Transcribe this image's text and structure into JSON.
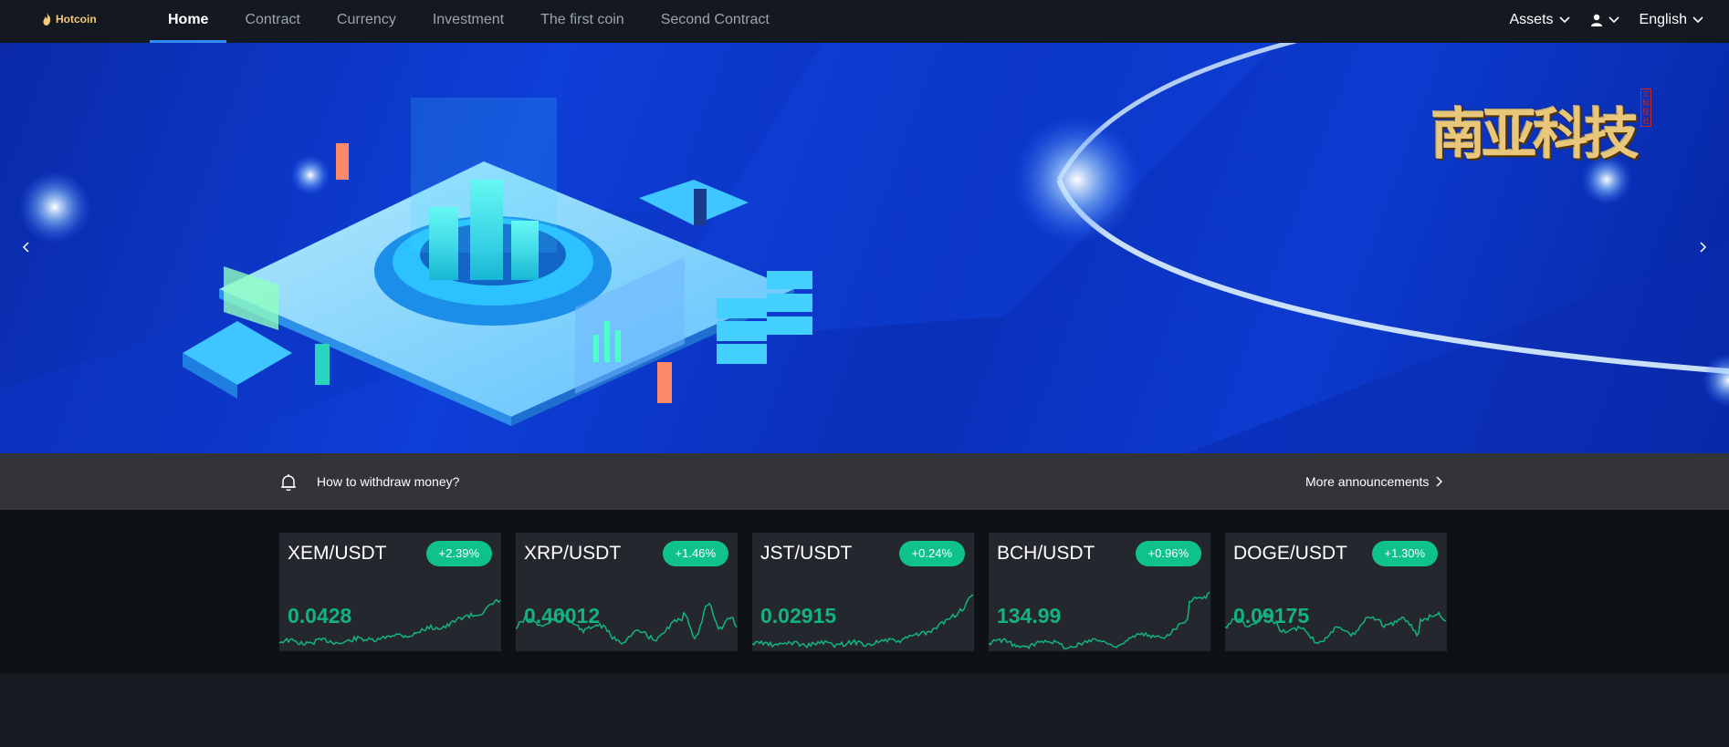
{
  "nav": {
    "logo_text": "Hotcoin",
    "tabs": [
      {
        "label": "Home",
        "active": true
      },
      {
        "label": "Contract"
      },
      {
        "label": "Currency"
      },
      {
        "label": "Investment"
      },
      {
        "label": "The first coin"
      },
      {
        "label": "Second Contract"
      }
    ],
    "assets_label": "Assets",
    "user_icon": "user-icon",
    "language_label": "English"
  },
  "banner": {
    "brand_text": "南亚科技",
    "brand_seal": "立标技社",
    "prev_icon": "chevron-left-icon",
    "next_icon": "chevron-right-icon"
  },
  "notice": {
    "icon": "bell-icon",
    "message": "How to withdraw money?",
    "more_label": "More announcements"
  },
  "market": {
    "accent_up": "#0ec28a",
    "cards": [
      {
        "pair": "XEM/USDT",
        "change": "+2.39%",
        "price": "0.0428"
      },
      {
        "pair": "XRP/USDT",
        "change": "+1.46%",
        "price": "0.40012"
      },
      {
        "pair": "JST/USDT",
        "change": "+0.24%",
        "price": "0.02915"
      },
      {
        "pair": "BCH/USDT",
        "change": "+0.96%",
        "price": "134.99"
      },
      {
        "pair": "DOGE/USDT",
        "change": "+1.30%",
        "price": "0.09175"
      }
    ]
  }
}
